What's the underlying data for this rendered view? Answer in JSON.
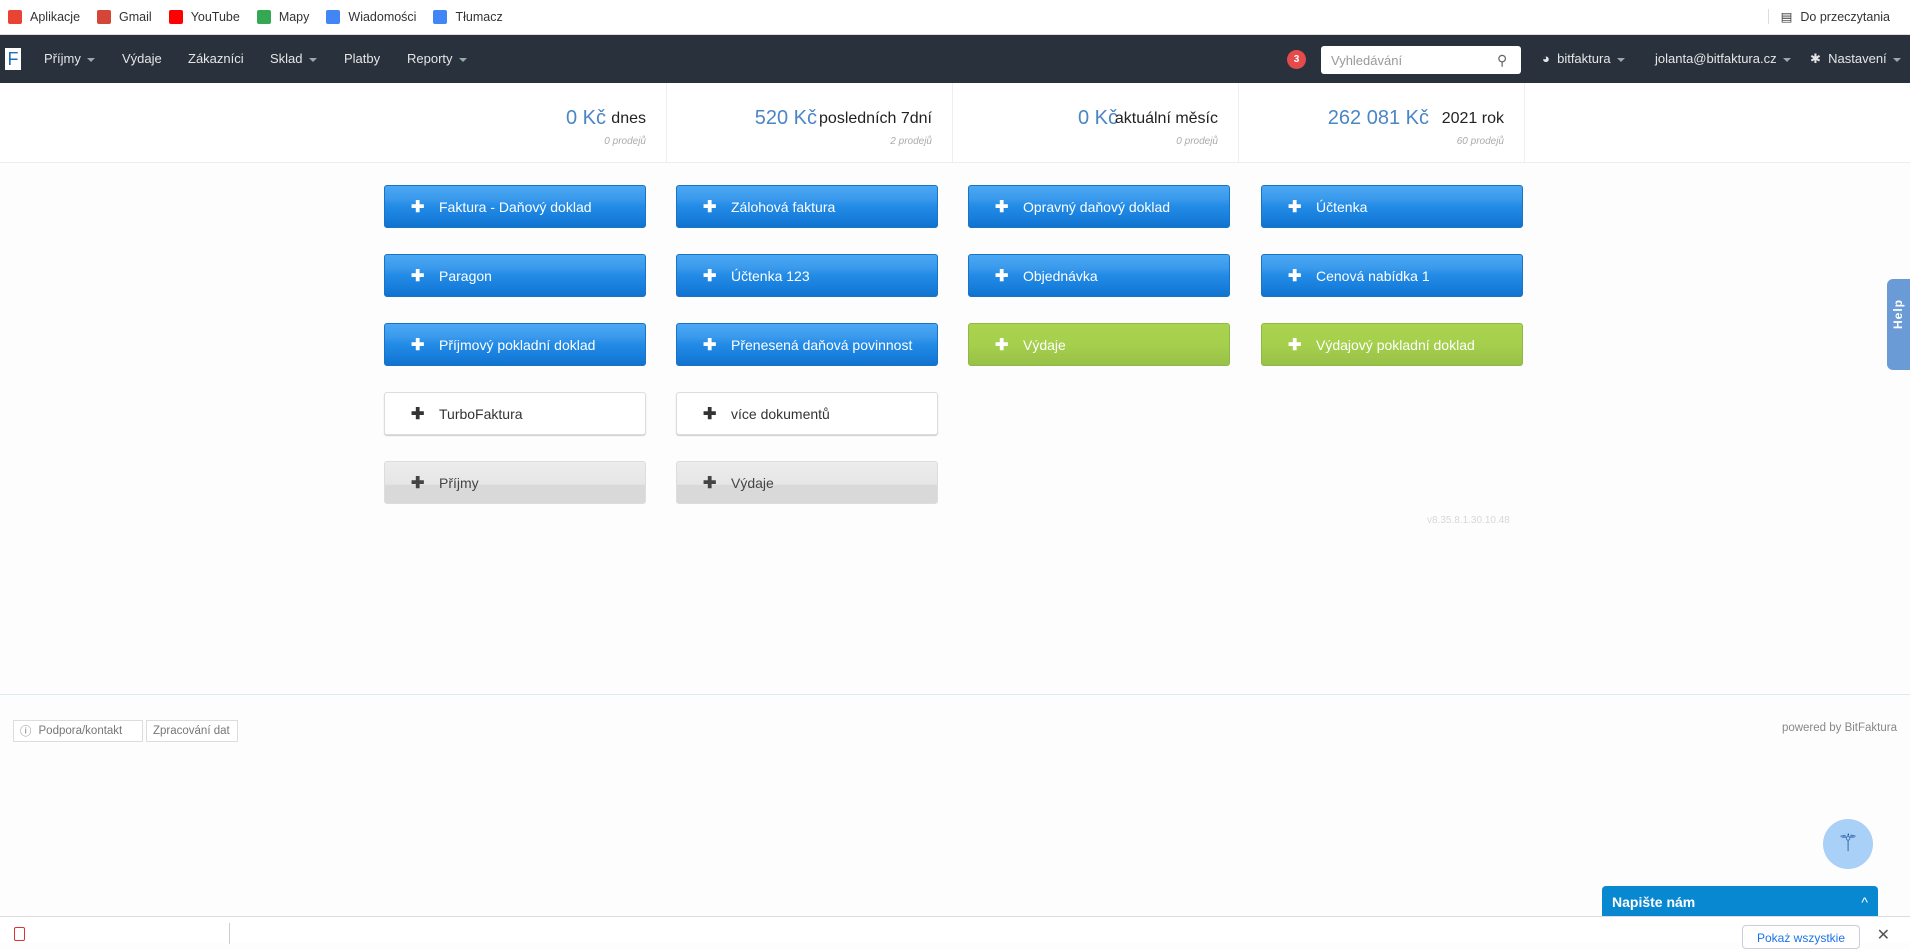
{
  "bookmarks": [
    {
      "label": "Aplikacje",
      "icon": "apps-grid-icon",
      "color": "#e94335"
    },
    {
      "label": "Gmail",
      "icon": "gmail-icon",
      "color": "#d44638"
    },
    {
      "label": "YouTube",
      "icon": "youtube-icon",
      "color": "#ff0000"
    },
    {
      "label": "Mapy",
      "icon": "maps-icon",
      "color": "#34a853"
    },
    {
      "label": "Wiadomości",
      "icon": "news-icon",
      "color": "#4285f4"
    },
    {
      "label": "Tłumacz",
      "icon": "translate-icon",
      "color": "#4285f4"
    }
  ],
  "reading_list": "Do przeczytania",
  "nav": {
    "logo": "F",
    "items": [
      {
        "label": "Příjmy",
        "dropdown": true
      },
      {
        "label": "Výdaje"
      },
      {
        "label": "Zákazníci"
      },
      {
        "label": "Sklad",
        "dropdown": true
      },
      {
        "label": "Platby"
      },
      {
        "label": "Reporty",
        "dropdown": true
      }
    ],
    "notification_count": "3",
    "search_placeholder": "Vyhledávání",
    "account": "bitfaktura",
    "user": "jolanta@bitfaktura.cz",
    "settings": "Nastavení"
  },
  "stats": [
    {
      "amount": "0 Kč",
      "period": "dnes",
      "count": "0 prodejů"
    },
    {
      "amount": "520 Kč",
      "period": "posledních 7dní",
      "count": "2 prodejů"
    },
    {
      "amount": "0 Kč",
      "period": "aktuální měsíc",
      "count": "0 prodejů"
    },
    {
      "amount": "262 081 Kč",
      "period": "2021 rok",
      "count": "60 prodejů"
    }
  ],
  "buttons": [
    {
      "label": "Faktura - Daňový doklad",
      "style": "blue"
    },
    {
      "label": "Zálohová faktura",
      "style": "blue"
    },
    {
      "label": "Opravný daňový doklad",
      "style": "blue"
    },
    {
      "label": "Účtenka",
      "style": "blue"
    },
    {
      "label": "Paragon",
      "style": "blue"
    },
    {
      "label": "Účtenka 123",
      "style": "blue"
    },
    {
      "label": "Objednávka",
      "style": "blue"
    },
    {
      "label": "Cenová nabídka 1",
      "style": "blue"
    },
    {
      "label": "Příjmový pokladní doklad",
      "style": "blue"
    },
    {
      "label": "Přenesená daňová povinnost",
      "style": "blue"
    },
    {
      "label": "Výdaje",
      "style": "green"
    },
    {
      "label": "Výdajový pokladní doklad",
      "style": "green"
    },
    {
      "label": "TurboFaktura",
      "style": "white"
    },
    {
      "label": "více dokumentů",
      "style": "white"
    },
    {
      "label": "Příjmy",
      "style": "gray"
    },
    {
      "label": "Výdaje",
      "style": "gray"
    }
  ],
  "version": "v8.35.8.1.30.10.48",
  "footer": {
    "support": "Podpora/kontakt",
    "data_processing": "Zpracování dat",
    "powered": "powered by BitFaktura"
  },
  "help": "Help",
  "chat": {
    "title": "Napište nám",
    "chevron": "^"
  },
  "downloads": {
    "show_all": "Pokaż wszystkie",
    "close": "✕"
  },
  "colors": {
    "navbar": "#29313c",
    "primary_button": "#228be6",
    "green_button": "#a5cf4c",
    "amount": "#4a86c5",
    "badge": "#e54b4b",
    "chat": "#0788d1"
  }
}
